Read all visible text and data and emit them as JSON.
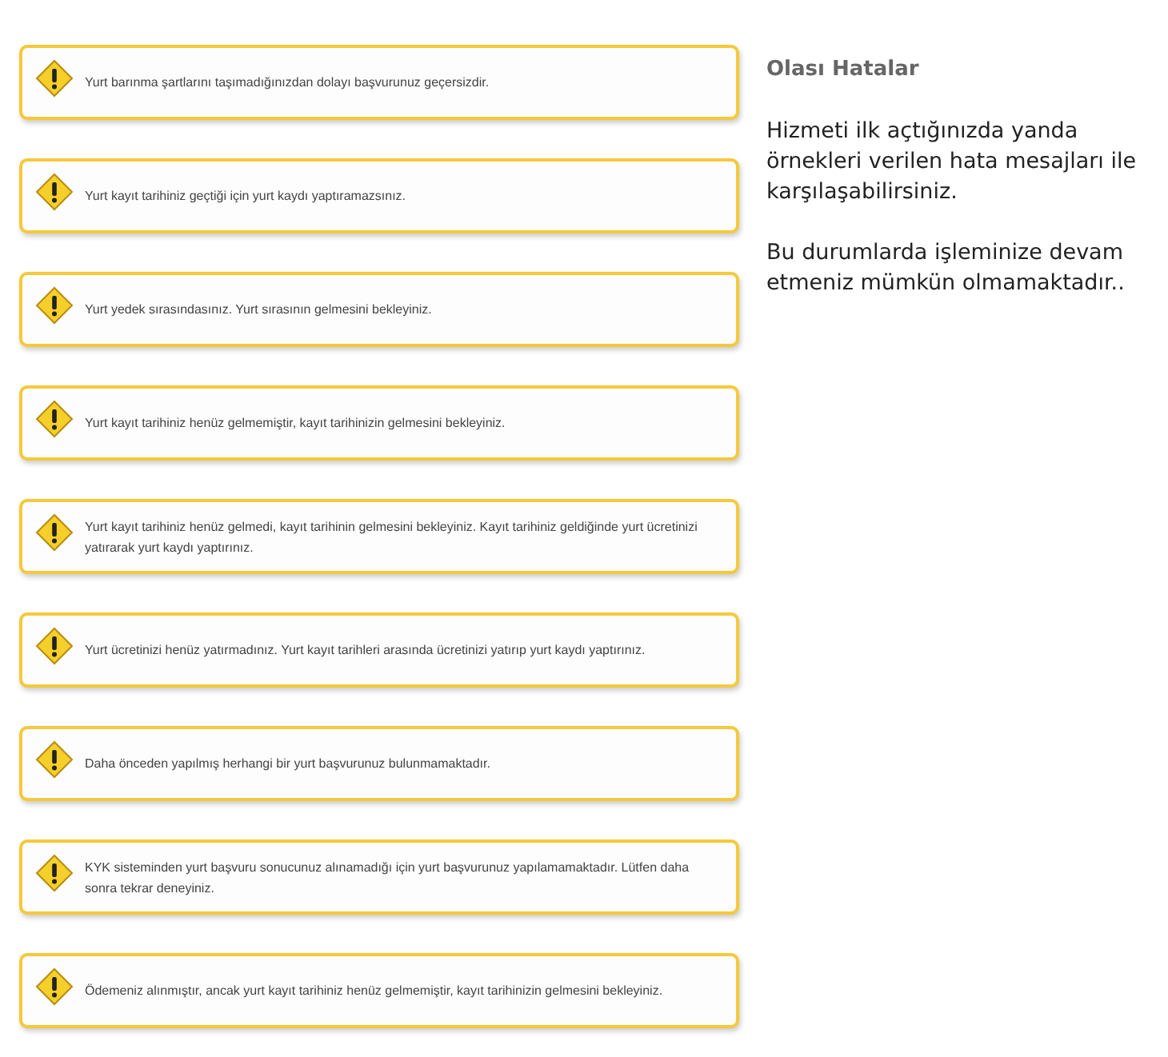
{
  "alerts": [
    {
      "message": "Yurt barınma şartlarını taşımadığınızdan dolayı başvurunuz geçersizdir."
    },
    {
      "message": "Yurt kayıt tarihiniz geçtiği için yurt kaydı yaptıramazsınız."
    },
    {
      "message": "Yurt yedek sırasındasınız. Yurt sırasının gelmesini bekleyiniz."
    },
    {
      "message": "Yurt kayıt tarihiniz henüz gelmemiştir, kayıt tarihinizin gelmesini bekleyiniz."
    },
    {
      "message": "Yurt kayıt tarihiniz henüz gelmedi, kayıt tarihinin gelmesini bekleyiniz. Kayıt tarihiniz geldiğinde yurt ücretinizi yatırarak yurt kaydı yaptırınız."
    },
    {
      "message": "Yurt ücretinizi henüz yatırmadınız. Yurt kayıt tarihleri arasında ücretinizi yatırıp yurt kaydı yaptırınız."
    },
    {
      "message": "Daha önceden yapılmış herhangi bir yurt başvurunuz bulunmamaktadır."
    },
    {
      "message": "KYK sisteminden yurt başvuru sonucunuz alınamadığı için yurt başvurunuz yapılamamaktadır. Lütfen daha sonra tekrar deneyiniz."
    },
    {
      "message": "Ödemeniz alınmıştır, ancak yurt kayıt tarihiniz henüz gelmemiştir, kayıt tarihinizin gelmesini bekleyiniz."
    }
  ],
  "side": {
    "title": "Olası Hatalar",
    "paragraphs": [
      "Hizmeti ilk açtığınızda yanda örnekleri verilen hata mesajları ile karşılaşabilirsiniz.",
      "Bu durumlarda işleminize devam etmeniz mümkün olmamaktadır.."
    ]
  }
}
